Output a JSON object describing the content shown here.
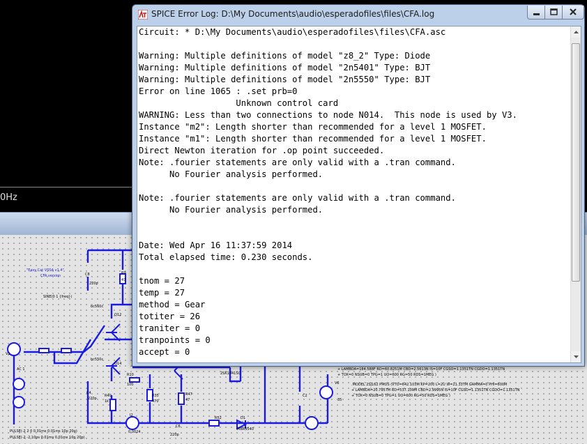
{
  "waveform": {
    "tick_label": "0Hz"
  },
  "log_window": {
    "title": "SPICE Error Log: D:\\My Documents\\audio\\esperadofiles\\files\\CFA.log",
    "lines": [
      "Circuit: * D:\\My Documents\\audio\\esperadofiles\\files\\CFA.asc",
      "",
      "Warning: Multiple definitions of model \"z8_2\" Type: Diode",
      "Warning: Multiple definitions of model \"2n5401\" Type: BJT",
      "Warning: Multiple definitions of model \"2n5550\" Type: BJT",
      "Error on line 1065 : .set prb=0",
      "                   Unknown control card",
      "WARNING: Less than two connections to node N014.  This node is used by V3.",
      "Instance \"m2\": Length shorter than recommended for a level 1 MOSFET.",
      "Instance \"m1\": Length shorter than recommended for a level 1 MOSFET.",
      "Direct Newton iteration for .op point succeeded.",
      "Note: .fourier statements are only valid with a .tran command.",
      "      No Fourier analysis performed.",
      "",
      "Note: .fourier statements are only valid with a .tran command.",
      "      No Fourier analysis performed.",
      "",
      "",
      "Date: Wed Apr 16 11:37:59 2014",
      "Total elapsed time: 0.230 seconds.",
      "",
      "tnom = 27",
      "temp = 27",
      "method = Gear",
      "totiter = 26",
      "traniter = 0",
      "tranpoints = 0",
      "accept = 0"
    ]
  },
  "schematic": {
    "title_text": "\"Easy Cat VSSA v1.4\"",
    "subtitle_text": "CFA version",
    "sine_text": "SINE(0 1 {freq})",
    "labels": {
      "v1": "V1",
      "ac": "AC 1",
      "c8": "C8",
      "c8v": "220p",
      "r9": "R9",
      "r9v": "47",
      "q12": "Q12",
      "q14": "Q14",
      "q12m": "bc560c",
      "q14m": "bc550c",
      "r10": "R10",
      "r10v": "100",
      "r40": "R40",
      "r40v": "1k",
      "c4": "C4",
      "c4v": "220p",
      "r35": "R35",
      "r35v": "470",
      "r47": "R47",
      "r47v": "47",
      "i2": "I2",
      "i2v": "0.0024",
      "c6": "C6",
      "c6v": "220p",
      "r52": "R52",
      "d1": "D1",
      "d1m": "MBR3540",
      "c2": "C2",
      "v6": "V6",
      "v6v": "35",
      "pulse1": "PULSE(-2 2 0 0.01ms 0.01ms 10p 20p)",
      "pulse2": "PULSE(-2 -2 10ps 0.01ms 0.01ms 10p 20p)",
      "model1": "+ LAMBDA=184.588F RD=60.8251M CBD=2.5613N IS=10F CGSO=1.1351TN CGDO=1.1351TN",
      "model2": "+ TOX=0 NSUB=0 TPG=1 UO=600 RG=50 RDS=1MEG )",
      "model3": ".MODEL 2SJ162 PMOS (VTO=642.103M KP=200 L=2U W=21.33TM GAMMA=0 PHI=600M",
      "model4": "+ LAMBDA=20.7957M RD=537.109M CBD=2.9995N IS=10F CGSO=1.1351TN CGDO=1.1351TN",
      "model5": "+ TOX=0 NSUB=0 TPG=1 UO=600 RG=50 RDS=1MEG )",
      "model6": "2SK1041SC"
    }
  },
  "colors": {
    "log_frame": "#bdd0ea",
    "schematic_wire": "#1a1ae0",
    "schematic_bg": "#e4e4e4"
  }
}
